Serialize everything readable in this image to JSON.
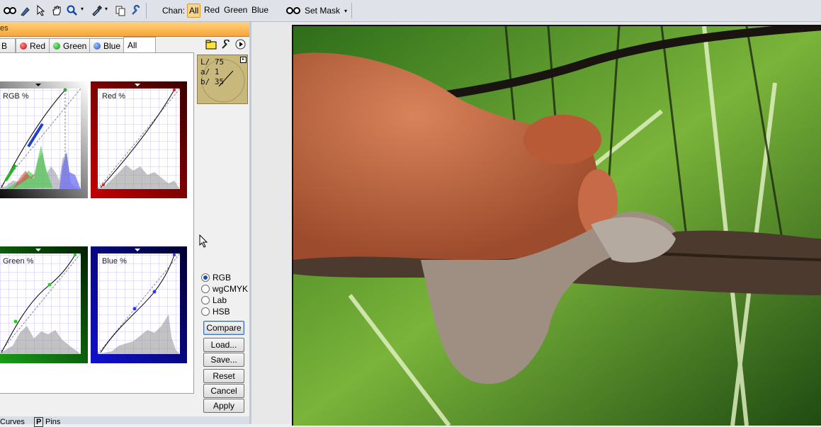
{
  "toolbar": {
    "tools": [
      "mask-tool",
      "brush-tool",
      "pointer-tool",
      "hand-tool",
      "zoom-tool",
      "eyedropper-tool",
      "copy-tool",
      "wrench-tool"
    ],
    "chan_label": "Chan:",
    "channels": [
      "All",
      "Red",
      "Green",
      "Blue"
    ],
    "active_channel": "All",
    "set_mask_label": "Set Mask"
  },
  "panel": {
    "header_title": "es",
    "tabs": [
      {
        "label": "B",
        "color": ""
      },
      {
        "label": "Red",
        "color": "#d62020"
      },
      {
        "label": "Green",
        "color": "#21a32a"
      },
      {
        "label": "Blue",
        "color": "#2f6fd8"
      },
      {
        "label": "All",
        "color": ""
      }
    ],
    "selected_tab": "All",
    "curves": [
      {
        "label": "RGB %"
      },
      {
        "label": "Red %"
      },
      {
        "label": "Green %"
      },
      {
        "label": "Blue %"
      }
    ],
    "readout": {
      "L": "L/ 75",
      "a": "a/  1",
      "b": "b/ 35"
    },
    "color_modes": [
      "RGB",
      "wgCMYK",
      "Lab",
      "HSB"
    ],
    "selected_mode": "RGB",
    "buttons": {
      "compare": "Compare",
      "load": "Load...",
      "save": "Save...",
      "reset": "Reset",
      "cancel": "Cancel",
      "apply": "Apply"
    }
  },
  "bottom_tabs": [
    "Curves",
    "Pins"
  ],
  "colors": {
    "accent_orange": "#f9a43a",
    "red_frame": "#c40000",
    "green_frame": "#1b8f1b",
    "blue_frame": "#0b0b9a"
  }
}
